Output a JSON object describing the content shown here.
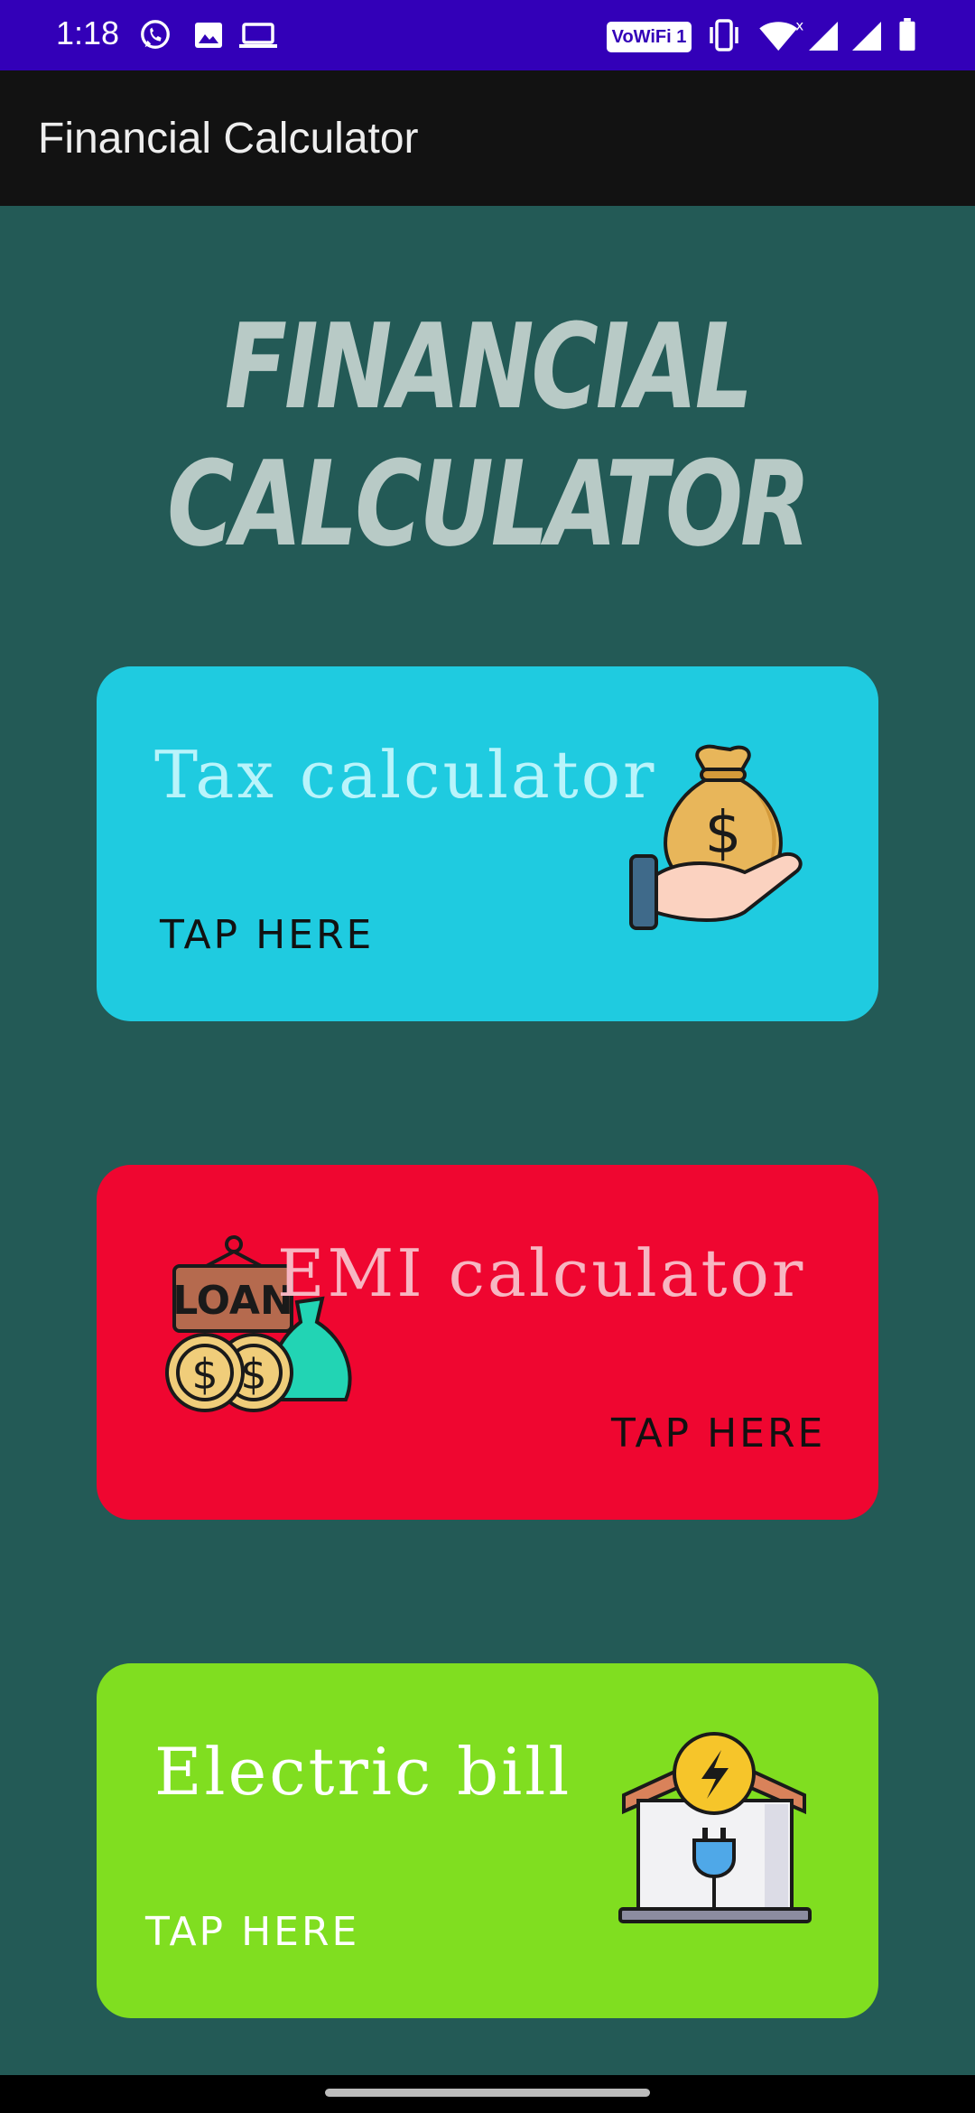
{
  "status_bar": {
    "time": "1:18",
    "icons": [
      "whatsapp-icon",
      "image-icon",
      "laptop-icon",
      "vowifi-badge",
      "vibrate-icon",
      "wifi-icon",
      "signal-icon",
      "signal-icon",
      "battery-icon"
    ],
    "wifi_badge": "VoWiFi 1",
    "background": "#3300b8"
  },
  "app_bar": {
    "title": "Financial Calculator",
    "background": "#121212"
  },
  "hero": {
    "line1": "FINANCIAL",
    "line2": "CALCULATOR",
    "color": "#b8cac6"
  },
  "cards": [
    {
      "title": "Tax calculator",
      "tap": "TAP HERE",
      "color": "#1fcbe0",
      "icon": "money-bag-hand-icon"
    },
    {
      "title": "EMI calculator",
      "tap": "TAP HERE",
      "color": "#ef0630",
      "icon": "loan-sign-coins-icon",
      "art_label": "LOAN"
    },
    {
      "title": "Electric bill",
      "tap": "TAP HERE",
      "color": "#80de20",
      "icon": "electric-house-icon"
    }
  ],
  "background": "#235a56"
}
